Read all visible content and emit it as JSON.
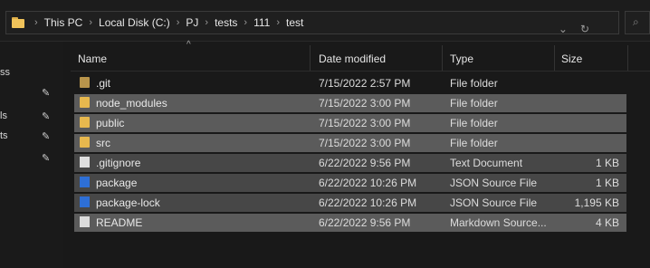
{
  "address_bar": {
    "crumbs": [
      "This PC",
      "Local Disk (C:)",
      "PJ",
      "tests",
      "111",
      "test"
    ],
    "dropdown_icon": "chevron-down-icon",
    "refresh_icon": "refresh-icon"
  },
  "nav_pane": {
    "labels": [
      "ss",
      "ls",
      "ts"
    ],
    "pin_icon": "pin-icon"
  },
  "columns": {
    "name": "Name",
    "date": "Date modified",
    "type": "Type",
    "size": "Size"
  },
  "files": [
    {
      "name": ".git",
      "date": "7/15/2022 2:57 PM",
      "type": "File folder",
      "size": "",
      "icon": "folder-icon"
    },
    {
      "name": "node_modules",
      "date": "7/15/2022 3:00 PM",
      "type": "File folder",
      "size": "",
      "icon": "folder-icon"
    },
    {
      "name": "public",
      "date": "7/15/2022 3:00 PM",
      "type": "File folder",
      "size": "",
      "icon": "folder-icon"
    },
    {
      "name": "src",
      "date": "7/15/2022 3:00 PM",
      "type": "File folder",
      "size": "",
      "icon": "folder-icon"
    },
    {
      "name": ".gitignore",
      "date": "6/22/2022 9:56 PM",
      "type": "Text Document",
      "size": "1 KB",
      "icon": "text-file-icon"
    },
    {
      "name": "package",
      "date": "6/22/2022 10:26 PM",
      "type": "JSON Source File",
      "size": "1 KB",
      "icon": "json-file-icon"
    },
    {
      "name": "package-lock",
      "date": "6/22/2022 10:26 PM",
      "type": "JSON Source File",
      "size": "1,195 KB",
      "icon": "json-file-icon"
    },
    {
      "name": "README",
      "date": "6/22/2022 9:56 PM",
      "type": "Markdown Source...",
      "size": "4 KB",
      "icon": "markdown-file-icon"
    }
  ]
}
